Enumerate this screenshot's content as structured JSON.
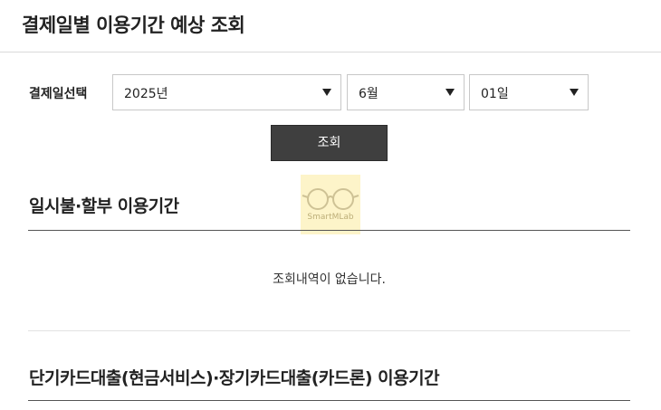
{
  "header": {
    "title": "결제일별 이용기간 예상 조회"
  },
  "date_select": {
    "label": "결제일선택",
    "year": "2025년",
    "month": "6월",
    "day": "01일"
  },
  "query_button": "조회",
  "watermark": {
    "text": "SmartMLab"
  },
  "section1": {
    "title": "일시불·할부 이용기간",
    "empty_message": "조회내역이 없습니다."
  },
  "section2": {
    "title": "단기카드대출(현금서비스)·장기카드대출(카드론) 이용기간"
  }
}
